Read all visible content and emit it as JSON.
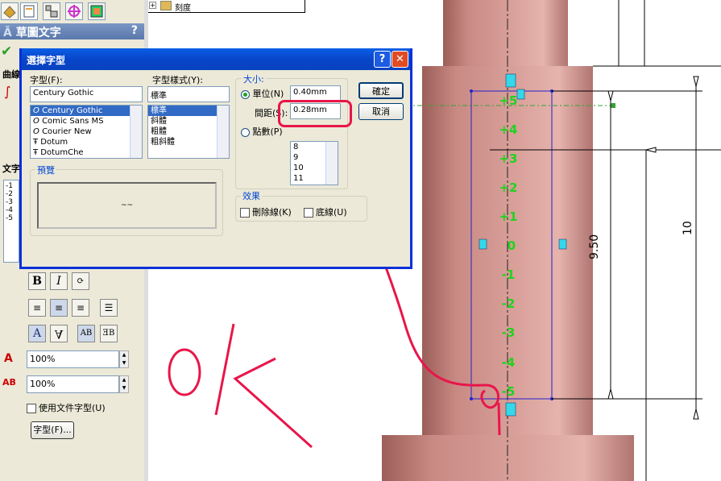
{
  "tree": {
    "item": "刻度"
  },
  "panel": {
    "title": "草圖文字",
    "help": "?",
    "side_labels": [
      "曲線",
      "文字"
    ],
    "text_lines": [
      "-1",
      "-2",
      "-3",
      "-4",
      "-5"
    ],
    "pct1": "100%",
    "pct2": "100%",
    "use_doc_font": "使用文件字型(U)",
    "font_button": "字型(F)..."
  },
  "dialog": {
    "title": "選擇字型",
    "help": "?",
    "close": "✕",
    "font_label": "字型(F):",
    "font_value": "Century Gothic",
    "fonts": [
      "Century Gothic",
      "Comic Sans MS",
      "Courier New",
      "Dotum",
      "DotumChe"
    ],
    "style_label": "字型樣式(Y):",
    "style_value": "標準",
    "styles": [
      "標準",
      "斜體",
      "粗體",
      "粗斜體"
    ],
    "size_group": "大小:",
    "unit_label": "單位(N)",
    "unit_value": "0.40mm",
    "spacing_label": "間距(S):",
    "spacing_value": "0.28mm",
    "points_label": "點數(P)",
    "points": [
      "8",
      "9",
      "10",
      "11"
    ],
    "ok": "確定",
    "cancel": "取消",
    "preview_label": "預覽",
    "preview_text": "~~",
    "effects_group": "效果",
    "strike": "刪除線(K)",
    "underline": "底線(U)"
  },
  "drawing": {
    "scale_labels": [
      "+5",
      "+4",
      "+3",
      "+2",
      "+1",
      "0",
      "-1",
      "-2",
      "-3",
      "-4",
      "-5"
    ],
    "dim_950": "9.50",
    "dim_10": "10",
    "annotation": "OK"
  },
  "colors": {
    "accent": "#e8164a",
    "scale_green": "#1fd31f",
    "shaft": "#c98a84"
  }
}
